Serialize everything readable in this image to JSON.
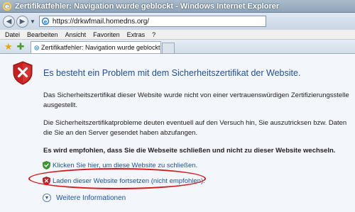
{
  "window": {
    "title": "Zertifikatfehler: Navigation wurde geblockt - Windows Internet Explorer"
  },
  "address_bar": {
    "url": "https://drkwfmail.homedns.org/"
  },
  "menu": {
    "items": [
      "Datei",
      "Bearbeiten",
      "Ansicht",
      "Favoriten",
      "Extras",
      "?"
    ]
  },
  "tabs": [
    {
      "label": "Zertifikatfehler: Navigation wurde geblockt"
    }
  ],
  "page": {
    "heading": "Es besteht ein Problem mit dem Sicherheitszertifikat der Website.",
    "paragraphs": [
      "Das Sicherheitszertifikat dieser Website wurde nicht von einer vertrauenswürdigen Zertifizierungsstelle ausgestellt.",
      "Die Sicherheitszertifikatprobleme deuten eventuell auf den Versuch hin, Sie auszutricksen bzw. Daten die Sie an den Server gesendet haben abzufangen."
    ],
    "recommendation": "Es wird empfohlen, dass Sie die Webseite schließen und nicht zu dieser Website wechseln.",
    "actions": [
      {
        "label": "Klicken Sie hier, um diese Website zu schließen.",
        "icon": "green-shield-check-icon"
      },
      {
        "label": "Laden dieser Website fortsetzen (nicht empfohlen).",
        "icon": "red-shield-x-icon"
      }
    ],
    "more_info": "Weitere Informationen"
  },
  "colors": {
    "heading": "#1f4f9a",
    "link": "#1a56a6",
    "annotation": "#d8191b",
    "error_shield": "#c8201e"
  }
}
